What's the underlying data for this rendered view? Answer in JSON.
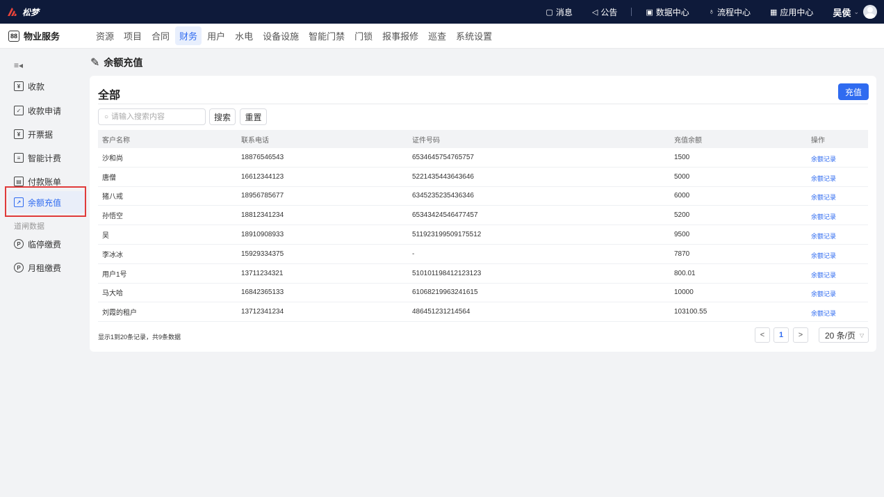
{
  "app": {
    "brand": "松梦"
  },
  "topbar": {
    "items": [
      {
        "icon": "message-icon",
        "glyph": "▢",
        "label": "消息"
      },
      {
        "icon": "announcement-icon",
        "glyph": "◁",
        "label": "公告"
      },
      {
        "icon": "data-center-icon",
        "glyph": "▣",
        "label": "数据中心"
      },
      {
        "icon": "workflow-icon",
        "glyph": "♁",
        "label": "流程中心"
      },
      {
        "icon": "apps-icon",
        "glyph": "▦",
        "label": "应用中心"
      }
    ],
    "user": "吴侯"
  },
  "module": {
    "title": "物业服务",
    "nav": [
      "资源",
      "项目",
      "合同",
      "财务",
      "用户",
      "水电",
      "设备设施",
      "智能门禁",
      "门锁",
      "报事报修",
      "巡查",
      "系统设置"
    ],
    "active_nav": "财务"
  },
  "sidebar": {
    "items": [
      {
        "label": "收款",
        "icon": "receipt-icon",
        "glyph": "¥"
      },
      {
        "label": "收款申请",
        "icon": "application-icon",
        "glyph": "✓"
      },
      {
        "label": "开票据",
        "icon": "invoice-icon",
        "glyph": "¥"
      },
      {
        "label": "智能计费",
        "icon": "billing-icon",
        "glyph": "≡"
      },
      {
        "label": "付款账单",
        "icon": "bill-icon",
        "glyph": "▤"
      },
      {
        "label": "余额充值",
        "icon": "recharge-icon",
        "glyph": "↗",
        "active": true
      }
    ],
    "group_label": "道闸数据",
    "group_items": [
      {
        "label": "临停缴费",
        "icon": "temp-parking-icon",
        "glyph": "P"
      },
      {
        "label": "月租缴费",
        "icon": "monthly-parking-icon",
        "glyph": "P"
      }
    ]
  },
  "page": {
    "title": "余额充值",
    "card_title": "全部",
    "recharge_button": "充值",
    "search_placeholder": "请输入搜索内容",
    "search_button": "搜索",
    "reset_button": "重置"
  },
  "table": {
    "headers": [
      "客户名称",
      "联系电话",
      "证件号码",
      "充值余额",
      "操作"
    ],
    "rows": [
      [
        "沙和尚",
        "18876546543",
        "6534645754765757",
        "1500",
        "余额记录"
      ],
      [
        "唐僧",
        "16612344123",
        "5221435443643646",
        "5000",
        "余额记录"
      ],
      [
        "猪八戒",
        "18956785677",
        "6345235235436346",
        "6000",
        "余额记录"
      ],
      [
        "孙悟空",
        "18812341234",
        "65343424546477457",
        "5200",
        "余额记录"
      ],
      [
        "吴",
        "18910908933",
        "511923199509175512",
        "9500",
        "余额记录"
      ],
      [
        "李冰冰",
        "15929334375",
        "-",
        "7870",
        "余额记录"
      ],
      [
        "用户1号",
        "13711234321",
        "510101198412123123",
        "800.01",
        "余额记录"
      ],
      [
        "马大哈",
        "16842365133",
        "61068219963241615",
        "10000",
        "余额记录"
      ],
      [
        "刘霞的租户",
        "13712341234",
        "486451231214564",
        "103100.55",
        "余额记录"
      ]
    ]
  },
  "pagination": {
    "summary": "显示1到20条记录，共9条数据",
    "prev": "<",
    "current_page": "1",
    "next": ">",
    "page_size": "20 条/页"
  },
  "colors": {
    "accent": "#2f6bf0",
    "topbar": "#0e1a3a",
    "highlight": "#e03a3a"
  }
}
